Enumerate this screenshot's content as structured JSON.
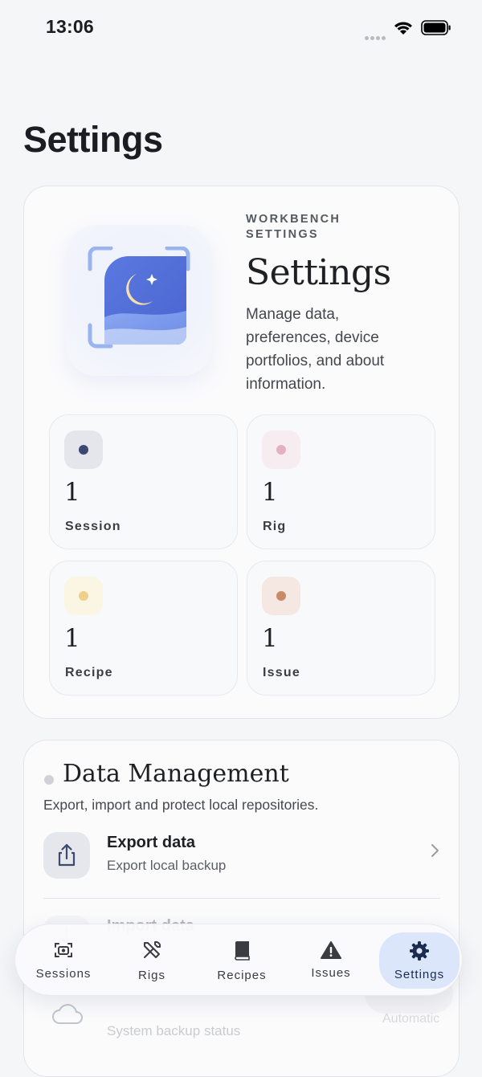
{
  "status_bar": {
    "time": "13:06"
  },
  "page": {
    "title": "Settings"
  },
  "hero": {
    "eyebrow": "WORKBENCH SETTINGS",
    "title": "Settings",
    "description": "Manage data, preferences, device portfolios, and about information."
  },
  "stats": [
    {
      "value": "1",
      "label": "Session",
      "dot_color": "#3b4873",
      "bg_color": "#e4e6ec"
    },
    {
      "value": "1",
      "label": "Rig",
      "dot_color": "#e2b2c3",
      "bg_color": "#f7ecf0"
    },
    {
      "value": "1",
      "label": "Recipe",
      "dot_color": "#efd08a",
      "bg_color": "#fbf6e4"
    },
    {
      "value": "1",
      "label": "Issue",
      "dot_color": "#c98a68",
      "bg_color": "#f5e7e1"
    }
  ],
  "data_management": {
    "title": "Data Management",
    "description": "Export, import and protect local repositories.",
    "rows": [
      {
        "title": "Export data",
        "subtitle": "Export local backup",
        "icon": "share-icon"
      },
      {
        "title": "Import data",
        "subtitle": "",
        "icon": "download-icon"
      },
      {
        "title": "",
        "subtitle": "System backup status",
        "icon": "cloud-icon",
        "value": "Automatic"
      }
    ]
  },
  "tabs": [
    {
      "label": "Sessions",
      "icon": "camera-icon",
      "active": false
    },
    {
      "label": "Rigs",
      "icon": "tools-icon",
      "active": false
    },
    {
      "label": "Recipes",
      "icon": "book-icon",
      "active": false
    },
    {
      "label": "Issues",
      "icon": "warning-icon",
      "active": false
    },
    {
      "label": "Settings",
      "icon": "gear-icon",
      "active": true
    }
  ],
  "colors": {
    "accent": "#dbe6fb",
    "tab_active_text": "#1b2b52"
  }
}
